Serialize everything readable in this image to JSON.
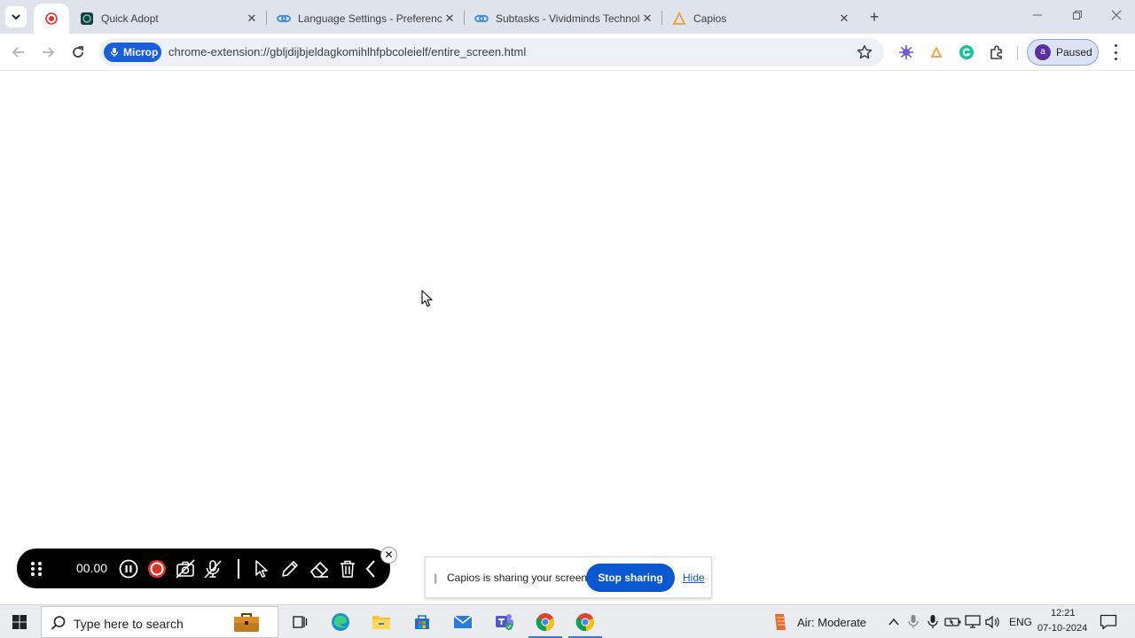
{
  "tabs": [
    {
      "title": "",
      "favicon": "record-icon",
      "active": true
    },
    {
      "title": "Quick Adopt",
      "favicon": "quick-adopt-icon",
      "active": false
    },
    {
      "title": "Language Settings - Preferences",
      "favicon": "link-icon",
      "active": false
    },
    {
      "title": "Subtasks - Vividminds Technologies",
      "favicon": "link-icon",
      "active": false
    },
    {
      "title": "Capios",
      "favicon": "capios-icon",
      "active": false
    }
  ],
  "toolbar": {
    "mic_chip_label": "Microp",
    "url": "chrome-extension://gbljdijbjeldagkomihlhfpbcoleielf/entire_screen.html",
    "profile_initial": "a",
    "profile_label": "Paused"
  },
  "recorder": {
    "timer": "00.00"
  },
  "sharing": {
    "message": "Capios is sharing your screen.",
    "stop_label": "Stop sharing",
    "hide_label": "Hide"
  },
  "taskbar": {
    "search_placeholder": "Type here to search",
    "weather": "Air: Moderate",
    "language": "ENG",
    "time": "12:21",
    "date": "07-10-2024"
  },
  "colors": {
    "accent": "#0b57d0",
    "mic_chip": "#1a5ed8",
    "record_red": "#e0312b"
  }
}
